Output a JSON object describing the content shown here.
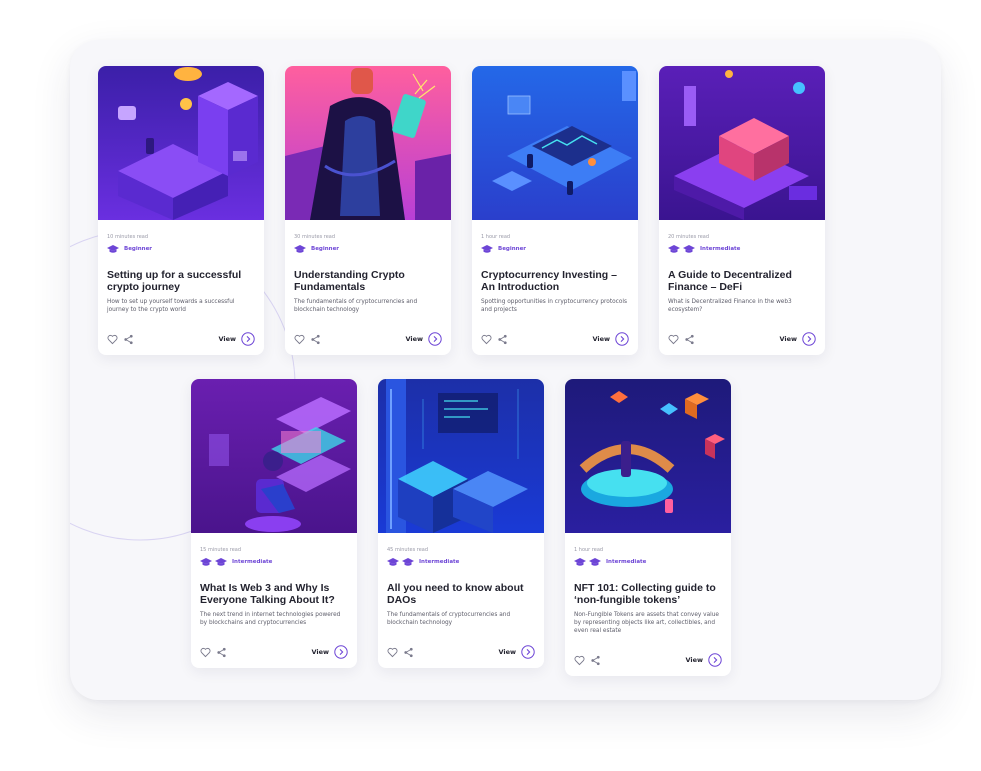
{
  "courses": [
    {
      "read_time": "10 minutes read",
      "level": "Beginner",
      "title": "Setting up for a successful crypto journey",
      "description": "How to set up yourself towards a successful journey to the crypto world",
      "view_label": "View"
    },
    {
      "read_time": "30 minutes read",
      "level": "Beginner",
      "title": "Understanding Crypto Fundamentals",
      "description": "The fundamentals of cryptocurrencies and blockchain technology",
      "view_label": "View"
    },
    {
      "read_time": "1 hour read",
      "level": "Beginner",
      "title": "Cryptocurrency Investing – An Introduction",
      "description": "Spotting opportunities in cryptocurrency protocols and projects",
      "view_label": "View"
    },
    {
      "read_time": "20 minutes read",
      "level": "Intermediate",
      "title": "A Guide to Decentralized Finance – DeFi",
      "description": "What is Decentralized Finance in the web3 ecosystem?",
      "view_label": "View"
    },
    {
      "read_time": "15 minutes read",
      "level": "Intermediate",
      "title": "What Is Web 3 and Why Is Everyone Talking About It?",
      "description": "The next trend in internet technologies powered by blockchains and cryptocurrencies",
      "view_label": "View"
    },
    {
      "read_time": "45 minutes read",
      "level": "Intermediate",
      "title": "All you need to know about DAOs",
      "description": "The fundamentals of cryptocurrencies and blockchain technology",
      "view_label": "View"
    },
    {
      "read_time": "1 hour read",
      "level": "Intermediate",
      "title": "NFT 101: Collecting guide to ‘non-fungible tokens’",
      "description": "Non-Fungible Tokens are assets that convey value by representing objects like art, collectibles, and even real estate",
      "view_label": "View"
    }
  ],
  "colors": {
    "accent": "#6d45d6",
    "frame_bg": "#f7f7fa",
    "card_bg": "#ffffff",
    "title": "#23232f",
    "muted": "#9a9aa8"
  },
  "icons": [
    "graduation-cap-icon",
    "heart-icon",
    "share-icon",
    "arrow-right-circle-icon"
  ]
}
